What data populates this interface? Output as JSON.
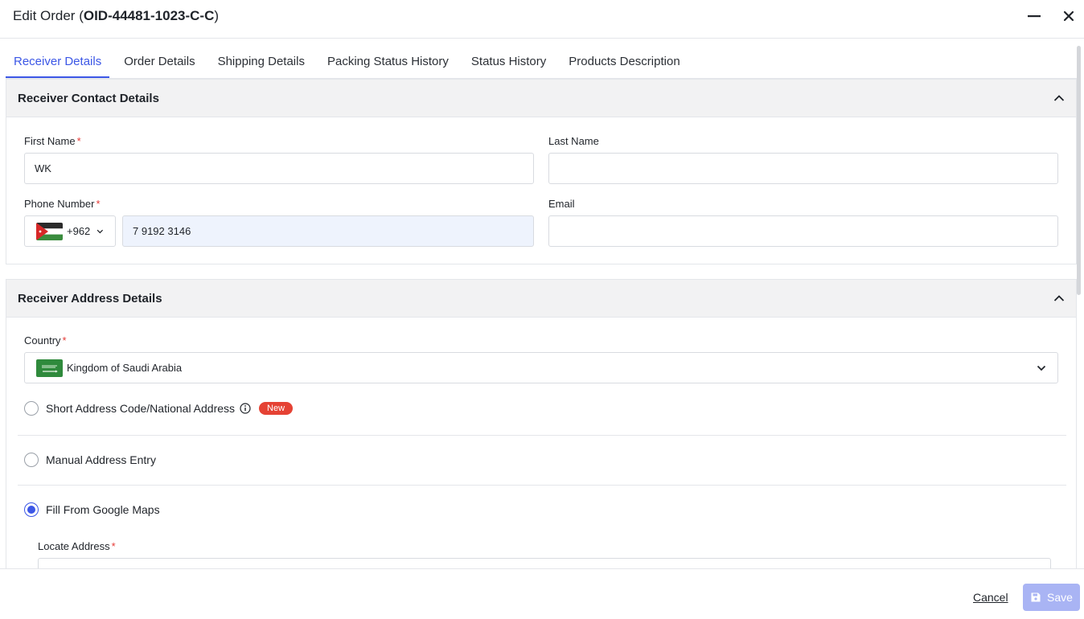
{
  "header": {
    "title_prefix": "Edit Order (",
    "order_id": "OID-44481-1023-C-C",
    "title_suffix": ")"
  },
  "tabs": [
    {
      "label": "Receiver Details",
      "active": true
    },
    {
      "label": "Order Details",
      "active": false
    },
    {
      "label": "Shipping Details",
      "active": false
    },
    {
      "label": "Packing Status History",
      "active": false
    },
    {
      "label": "Status History",
      "active": false
    },
    {
      "label": "Products Description",
      "active": false
    }
  ],
  "contact": {
    "section_title": "Receiver Contact Details",
    "first_name_label": "First Name",
    "first_name_value": "WK",
    "last_name_label": "Last Name",
    "last_name_value": "",
    "phone_label": "Phone Number",
    "phone_code": "+962",
    "phone_value": "7 9192 3146",
    "email_label": "Email",
    "email_value": "",
    "required_mark": "*"
  },
  "address": {
    "section_title": "Receiver Address Details",
    "country_label": "Country",
    "country_value": "Kingdom of Saudi Arabia",
    "option_short": "Short Address Code/National Address",
    "new_badge": "New",
    "option_manual": "Manual Address Entry",
    "option_google": "Fill From Google Maps",
    "locate_label": "Locate Address"
  },
  "footer": {
    "cancel_label": "Cancel",
    "save_label": "Save"
  },
  "colors": {
    "accent": "#3c57e6",
    "badge": "#e54234",
    "save_disabled": "#a9b4f4"
  }
}
